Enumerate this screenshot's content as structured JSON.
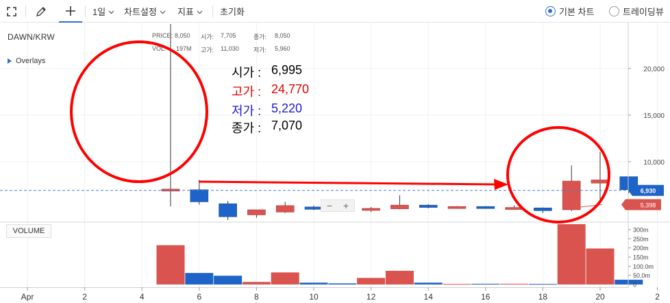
{
  "toolbar": {
    "interval_label": "1일",
    "chart_settings_label": "차트설정",
    "indicator_label": "지표",
    "reset_label": "초기화",
    "basic_chart_label": "기본 차트",
    "trading_view_label": "트레이딩뷰"
  },
  "chart": {
    "ticker": "DAWN/KRW",
    "overlays_label": "Overlays",
    "volume_label": "VOLUME",
    "info": {
      "price_label": "PRICE:",
      "price": "8,050",
      "open_label": "시가:",
      "open": "7,705",
      "close_label": "종가:",
      "close": "8,050",
      "vol_label": "VOL:",
      "vol": "197M",
      "high_label": "고가:",
      "high": "11,030",
      "low_label": "저가:",
      "low": "5,960"
    },
    "annotation": {
      "open_label": "시가 :",
      "open": "6,995",
      "high_label": "고가 :",
      "high": "24,770",
      "low_label": "저가 :",
      "low": "5,220",
      "close_label": "종가 :",
      "close": "7,070"
    },
    "price_badge": "6,930",
    "low_badge": "5,398",
    "colors": {
      "up": "#d9534f",
      "down": "#1e63c7",
      "accent": "#2b6cd6",
      "annotation": "#ff0000"
    }
  },
  "chart_data": {
    "type": "candlestick",
    "x_ticks": [
      "Apr",
      "2",
      "4",
      "6",
      "8",
      "10",
      "12",
      "14",
      "16",
      "18",
      "20",
      "2"
    ],
    "price_axis_ticks": [
      "20,000",
      "15,000",
      "10,000"
    ],
    "volume_axis_ticks": [
      "300m",
      "250m",
      "200m",
      "150m",
      "100.0m",
      "50.0m",
      "0"
    ],
    "ylim_price": [
      3600,
      24770
    ],
    "ylim_volume": [
      0,
      330
    ],
    "candles": [
      {
        "day": 5,
        "open": 6995,
        "high": 24770,
        "low": 5220,
        "close": 7070,
        "volume": 215
      },
      {
        "day": 6,
        "open": 7000,
        "high": 8050,
        "low": 5400,
        "close": 5700,
        "volume": 63
      },
      {
        "day": 7,
        "open": 5500,
        "high": 5800,
        "low": 3750,
        "close": 4100,
        "volume": 48
      },
      {
        "day": 8,
        "open": 4300,
        "high": 4850,
        "low": 4000,
        "close": 4850,
        "volume": 14
      },
      {
        "day": 9,
        "open": 4600,
        "high": 5700,
        "low": 4500,
        "close": 5300,
        "volume": 66
      },
      {
        "day": 10,
        "open": 5150,
        "high": 5300,
        "low": 4800,
        "close": 4900,
        "volume": 10
      },
      {
        "day": 11,
        "open": 4950,
        "high": 5250,
        "low": 4700,
        "close": 4800,
        "volume": 6
      },
      {
        "day": 12,
        "open": 4800,
        "high": 5150,
        "low": 4600,
        "close": 5000,
        "volume": 36
      },
      {
        "day": 13,
        "open": 4950,
        "high": 6400,
        "low": 4900,
        "close": 5350,
        "volume": 75
      },
      {
        "day": 14,
        "open": 5350,
        "high": 5450,
        "low": 5000,
        "close": 5100,
        "volume": 10
      },
      {
        "day": 15,
        "open": 5050,
        "high": 5250,
        "low": 4950,
        "close": 5200,
        "volume": 3
      },
      {
        "day": 16,
        "open": 5200,
        "high": 5250,
        "low": 4950,
        "close": 5000,
        "volume": 4
      },
      {
        "day": 17,
        "open": 4950,
        "high": 5300,
        "low": 4850,
        "close": 5100,
        "volume": 4
      },
      {
        "day": 18,
        "open": 5050,
        "high": 5100,
        "low": 4500,
        "close": 4750,
        "volume": 3
      },
      {
        "day": 19,
        "open": 4850,
        "high": 9600,
        "low": 4700,
        "close": 7930,
        "volume": 330
      },
      {
        "day": 20,
        "open": 7705,
        "high": 11030,
        "low": 5960,
        "close": 8050,
        "volume": 197
      },
      {
        "day": 21,
        "open": 8400,
        "high": 8400,
        "low": 6600,
        "close": 7000,
        "volume": 26
      }
    ]
  }
}
